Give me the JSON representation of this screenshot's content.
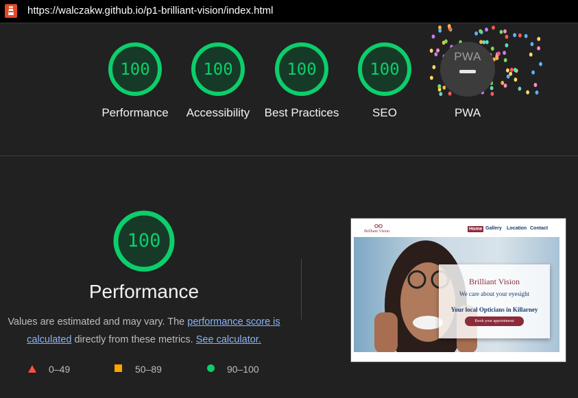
{
  "address_bar": {
    "url": "https://walczakw.github.io/p1-brilliant-vision/index.html"
  },
  "colors": {
    "pass": "#0cce6b",
    "average": "#ffa400",
    "fail": "#ff4e42",
    "link": "#8ab4f8"
  },
  "categories": [
    {
      "label": "Performance",
      "score": "100"
    },
    {
      "label": "Accessibility",
      "score": "100"
    },
    {
      "label": "Best Practices",
      "score": "100"
    },
    {
      "label": "SEO",
      "score": "100"
    },
    {
      "label": "PWA",
      "badge_text": "PWA",
      "icon": "pwa-badge-icon"
    }
  ],
  "performance": {
    "score": "100",
    "title": "Performance",
    "desc_start": "Values are estimated and may vary. The ",
    "desc_link": "performance score is calculated",
    "desc_middle": " directly from these metrics. ",
    "desc_calc": "See calculator."
  },
  "legend": [
    {
      "range": "0–49",
      "icon": "triangle-icon"
    },
    {
      "range": "50–89",
      "icon": "square-icon"
    },
    {
      "range": "90–100",
      "icon": "circle-icon"
    }
  ],
  "thumbnail": {
    "brand": "Brilliant Vision",
    "nav": [
      "Home",
      "Gallery",
      "Location",
      "Contact"
    ],
    "heading": "Brilliant Vision",
    "tagline": "We care about your eyesight",
    "location": "Your local Opticians in Killarney",
    "cta": "Book your appointment"
  }
}
